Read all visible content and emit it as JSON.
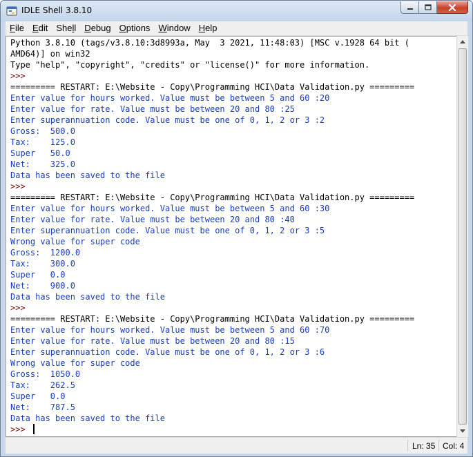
{
  "window": {
    "title": "IDLE Shell 3.8.10",
    "icon": "python-idle-icon"
  },
  "menu": [
    {
      "key": "F",
      "rest": "ile"
    },
    {
      "key": "E",
      "rest": "dit"
    },
    {
      "pre": "She",
      "key": "l",
      "rest": "l"
    },
    {
      "key": "D",
      "rest": "ebug"
    },
    {
      "key": "O",
      "rest": "ptions"
    },
    {
      "key": "W",
      "rest": "indow"
    },
    {
      "key": "H",
      "rest": "elp"
    }
  ],
  "colors": {
    "stdout": "#1a3ac4",
    "console": "#000000",
    "prompt": "#7a0000"
  },
  "shell_lines": [
    {
      "kind": "console",
      "text": "Python 3.8.10 (tags/v3.8.10:3d8993a, May  3 2021, 11:48:03) [MSC v.1928 64 bit ("
    },
    {
      "kind": "console",
      "text": "AMD64)] on win32"
    },
    {
      "kind": "console",
      "text": "Type \"help\", \"copyright\", \"credits\" or \"license()\" for more information."
    },
    {
      "kind": "prompt",
      "text": ">>> "
    },
    {
      "kind": "console",
      "text": "========= RESTART: E:\\Website - Copy\\Programming HCI\\Data Validation.py ========="
    },
    {
      "kind": "stdout",
      "text": "Enter value for hours worked. Value must be between 5 and 60 :20"
    },
    {
      "kind": "stdout",
      "text": "Enter value for rate. Value must be between 20 and 80 :25"
    },
    {
      "kind": "stdout",
      "text": "Enter superannuation code. Value must be one of 0, 1, 2 or 3 :2"
    },
    {
      "kind": "stdout",
      "text": "Gross:  500.0"
    },
    {
      "kind": "stdout",
      "text": "Tax:    125.0"
    },
    {
      "kind": "stdout",
      "text": "Super   50.0"
    },
    {
      "kind": "stdout",
      "text": "Net:    325.0"
    },
    {
      "kind": "stdout",
      "text": "Data has been saved to the file"
    },
    {
      "kind": "prompt",
      "text": ">>> "
    },
    {
      "kind": "console",
      "text": "========= RESTART: E:\\Website - Copy\\Programming HCI\\Data Validation.py ========="
    },
    {
      "kind": "stdout",
      "text": "Enter value for hours worked. Value must be between 5 and 60 :30"
    },
    {
      "kind": "stdout",
      "text": "Enter value for rate. Value must be between 20 and 80 :40"
    },
    {
      "kind": "stdout",
      "text": "Enter superannuation code. Value must be one of 0, 1, 2 or 3 :5"
    },
    {
      "kind": "stdout",
      "text": "Wrong value for super code"
    },
    {
      "kind": "stdout",
      "text": "Gross:  1200.0"
    },
    {
      "kind": "stdout",
      "text": "Tax:    300.0"
    },
    {
      "kind": "stdout",
      "text": "Super   0.0"
    },
    {
      "kind": "stdout",
      "text": "Net:    900.0"
    },
    {
      "kind": "stdout",
      "text": "Data has been saved to the file"
    },
    {
      "kind": "prompt",
      "text": ">>> "
    },
    {
      "kind": "console",
      "text": "========= RESTART: E:\\Website - Copy\\Programming HCI\\Data Validation.py ========="
    },
    {
      "kind": "stdout",
      "text": "Enter value for hours worked. Value must be between 5 and 60 :70"
    },
    {
      "kind": "stdout",
      "text": "Enter value for rate. Value must be between 20 and 80 :15"
    },
    {
      "kind": "stdout",
      "text": "Enter superannuation code. Value must be one of 0, 1, 2 or 3 :6"
    },
    {
      "kind": "stdout",
      "text": "Wrong value for super code"
    },
    {
      "kind": "stdout",
      "text": "Gross:  1050.0"
    },
    {
      "kind": "stdout",
      "text": "Tax:    262.5"
    },
    {
      "kind": "stdout",
      "text": "Super   0.0"
    },
    {
      "kind": "stdout",
      "text": "Net:    787.5"
    },
    {
      "kind": "stdout",
      "text": "Data has been saved to the file"
    },
    {
      "kind": "prompt",
      "text": ">>> ",
      "cursor": true
    }
  ],
  "status": {
    "line": "Ln: 35",
    "col": "Col: 4"
  }
}
